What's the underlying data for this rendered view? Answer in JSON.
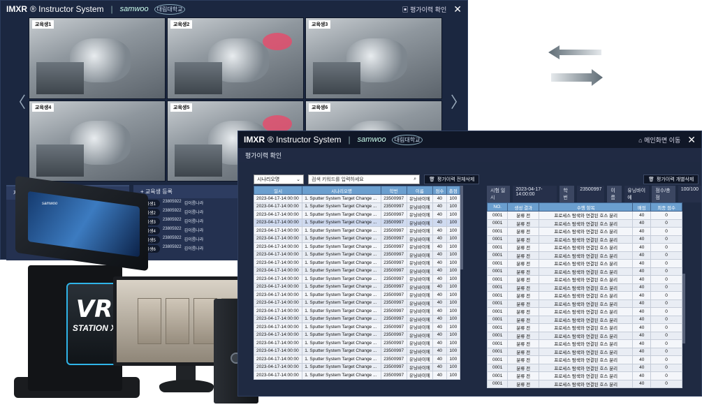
{
  "back_window": {
    "brand": "IMXR",
    "brand_suffix": "® Instructor System",
    "separator": "|",
    "logo": "samwoo",
    "university": "대림대학교",
    "action_label": "평가이력 확인",
    "close": "✕",
    "prev": "〈",
    "next": "〉",
    "cameras": [
      "교육생1",
      "교육생2",
      "교육생3",
      "교육생4",
      "교육생5",
      "교육생6"
    ],
    "left_panel_title": "재생 제어",
    "right_panel_title": "+ 교육생 등록",
    "students": [
      {
        "name": "교육생1",
        "id": "23805922",
        "label": "김이름나라"
      },
      {
        "name": "교육생2",
        "id": "23805922",
        "label": "김이름나라"
      },
      {
        "name": "교육생3",
        "id": "23805922",
        "label": "김이름나라"
      },
      {
        "name": "교육생4",
        "id": "23805922",
        "label": "김이름나라"
      },
      {
        "name": "교육생5",
        "id": "23805922",
        "label": "김이름나라"
      },
      {
        "name": "교육생6",
        "id": "23805922",
        "label": "김이름나라"
      }
    ]
  },
  "kiosk": {
    "brand": "samwoo",
    "vr": "VR",
    "station": "STATION X"
  },
  "front_window": {
    "brand": "IMXR",
    "brand_suffix": "® Instructor System",
    "separator": "|",
    "logo": "samwoo",
    "university": "대림대학교",
    "home_label": "메인화면 이동",
    "close": "✕",
    "subtitle": "평가이력 확인",
    "scenario_select": "시나리오명",
    "search_placeholder": "검색 키워드를 입력하세요",
    "delete_all": "평가이력 전체삭제",
    "delete_one": "평가이력 개별삭제",
    "info": {
      "date_k": "시험 일시",
      "date_v": "2023-04-17-14:00:00",
      "id_k": "학번",
      "id_v": "23500997",
      "name_k": "이름",
      "name_v": "유닝바이에",
      "score_k": "점수/총점",
      "score_v": "100/100"
    },
    "left_headers": [
      "일시",
      "시나리오명",
      "학번",
      "이름",
      "점수",
      "총점"
    ],
    "left_rows": [
      [
        "2023-04-17-14:00:00",
        "1. Sputter System Target Change ...",
        "23500997",
        "유닝바이에",
        "40",
        "100"
      ],
      [
        "2023-04-17-14:00:00",
        "1. Sputter System Target Change ...",
        "23500997",
        "유닝바이에",
        "40",
        "100"
      ],
      [
        "2023-04-17-14:00:00",
        "1. Sputter System Target Change ...",
        "23500997",
        "유닝바이에",
        "40",
        "100"
      ],
      [
        "2023-04-17-14:00:00",
        "1. Sputter System Target Change ...",
        "23500997",
        "유닝바이에",
        "40",
        "100"
      ],
      [
        "2023-04-17-14:00:00",
        "1. Sputter System Target Change ...",
        "23500997",
        "유닝바이에",
        "40",
        "100"
      ],
      [
        "2023-04-17-14:00:00",
        "1. Sputter System Target Change ...",
        "23500997",
        "유닝바이에",
        "40",
        "100"
      ],
      [
        "2023-04-17-14:00:00",
        "1. Sputter System Target Change ...",
        "23500997",
        "유닝바이에",
        "40",
        "100"
      ],
      [
        "2023-04-17-14:00:00",
        "1. Sputter System Target Change ...",
        "23500997",
        "유닝바이에",
        "40",
        "100"
      ],
      [
        "2023-04-17-14:00:00",
        "1. Sputter System Target Change ...",
        "23500997",
        "유닝바이에",
        "40",
        "100"
      ],
      [
        "2023-04-17-14:00:00",
        "1. Sputter System Target Change ...",
        "23500997",
        "유닝바이에",
        "40",
        "100"
      ],
      [
        "2023-04-17-14:00:00",
        "1. Sputter System Target Change ...",
        "23500997",
        "유닝바이에",
        "40",
        "100"
      ],
      [
        "2023-04-17-14:00:00",
        "1. Sputter System Target Change ...",
        "23500997",
        "유닝바이에",
        "40",
        "100"
      ],
      [
        "2023-04-17-14:00:00",
        "1. Sputter System Target Change ...",
        "23500997",
        "유닝바이에",
        "40",
        "100"
      ],
      [
        "2023-04-17-14:00:00",
        "1. Sputter System Target Change ...",
        "23500997",
        "유닝바이에",
        "40",
        "100"
      ],
      [
        "2023-04-17-14:00:00",
        "1. Sputter System Target Change ...",
        "23500997",
        "유닝바이에",
        "40",
        "100"
      ],
      [
        "2023-04-17-14:00:00",
        "1. Sputter System Target Change ...",
        "23500997",
        "유닝바이에",
        "40",
        "100"
      ],
      [
        "2023-04-17-14:00:00",
        "1. Sputter System Target Change ...",
        "23500997",
        "유닝바이에",
        "40",
        "100"
      ],
      [
        "2023-04-17-14:00:00",
        "1. Sputter System Target Change ...",
        "23500997",
        "유닝바이에",
        "40",
        "100"
      ],
      [
        "2023-04-17-14:00:00",
        "1. Sputter System Target Change ...",
        "23500997",
        "유닝바이에",
        "40",
        "100"
      ],
      [
        "2023-04-17-14:00:00",
        "1. Sputter System Target Change ...",
        "23500997",
        "유닝바이에",
        "40",
        "100"
      ],
      [
        "2023-04-17-14:00:00",
        "1. Sputter System Target Change ...",
        "23500997",
        "유닝바이에",
        "40",
        "100"
      ],
      [
        "2023-04-17-14:00:00",
        "1. Sputter System Target Change ...",
        "23500997",
        "유닝바이에",
        "40",
        "100"
      ],
      [
        "2023-04-17-14:00:00",
        "1. Sputter System Target Change ...",
        "23500997",
        "유닝바이에",
        "40",
        "100"
      ]
    ],
    "right_headers": [
      "NO.",
      "생성 결과",
      "수행 항목",
      "배점",
      "최종 점수"
    ],
    "right_rows": [
      [
        "0001",
        "분류 전",
        "프로세스 탐색와 연결된 호스 분리",
        "40",
        "0"
      ],
      [
        "0001",
        "분류 전",
        "프로세스 탐색와 연결된 호스 분리",
        "40",
        "0"
      ],
      [
        "0001",
        "분류 전",
        "프로세스 탐색와 연결된 호스 분리",
        "40",
        "0"
      ],
      [
        "0001",
        "분류 전",
        "프로세스 탐색와 연결된 호스 분리",
        "40",
        "0"
      ],
      [
        "0001",
        "분류 전",
        "프로세스 탐색와 연결된 호스 분리",
        "40",
        "0"
      ],
      [
        "0001",
        "분류 전",
        "프로세스 탐색와 연결된 호스 분리",
        "40",
        "0"
      ],
      [
        "0001",
        "분류 전",
        "프로세스 탐색와 연결된 호스 분리",
        "40",
        "0"
      ],
      [
        "0001",
        "분류 전",
        "프로세스 탐색와 연결된 호스 분리",
        "40",
        "0"
      ],
      [
        "0001",
        "분류 전",
        "프로세스 탐색와 연결된 호스 분리",
        "40",
        "0"
      ],
      [
        "0001",
        "분류 전",
        "프로세스 탐색와 연결된 호스 분리",
        "40",
        "0"
      ],
      [
        "0001",
        "분류 전",
        "프로세스 탐색와 연결된 호스 분리",
        "40",
        "0"
      ],
      [
        "0001",
        "분류 전",
        "프로세스 탐색와 연결된 호스 분리",
        "40",
        "0"
      ],
      [
        "0001",
        "분류 전",
        "프로세스 탐색와 연결된 호스 분리",
        "40",
        "0"
      ],
      [
        "0001",
        "분류 전",
        "프로세스 탐색와 연결된 호스 분리",
        "40",
        "0"
      ],
      [
        "0001",
        "분류 전",
        "프로세스 탐색와 연결된 호스 분리",
        "40",
        "0"
      ],
      [
        "0001",
        "분류 전",
        "프로세스 탐색와 연결된 호스 분리",
        "40",
        "0"
      ],
      [
        "0001",
        "분류 전",
        "프로세스 탐색와 연결된 호스 분리",
        "40",
        "0"
      ],
      [
        "0001",
        "분류 전",
        "프로세스 탐색와 연결된 호스 분리",
        "40",
        "0"
      ],
      [
        "0001",
        "분류 전",
        "프로세스 탐색와 연결된 호스 분리",
        "40",
        "0"
      ],
      [
        "0001",
        "분류 전",
        "프로세스 탐색와 연결된 호스 분리",
        "40",
        "0"
      ],
      [
        "0001",
        "분류 전",
        "프로세스 탐색와 연결된 호스 분리",
        "40",
        "0"
      ],
      [
        "0001",
        "분류 전",
        "프로세스 탐색와 연결된 호스 분리",
        "40",
        "0"
      ]
    ]
  },
  "colors": {
    "window_bg": "#1f2a42",
    "header_blue": "#6b9fcf",
    "accent_cyan": "#2fb4e8"
  }
}
